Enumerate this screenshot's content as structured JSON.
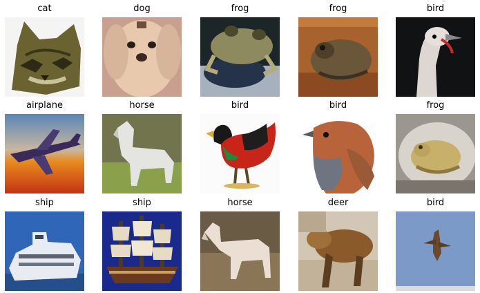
{
  "grid": {
    "rows": [
      [
        {
          "label": "cat"
        },
        {
          "label": "dog"
        },
        {
          "label": "frog"
        },
        {
          "label": "frog"
        },
        {
          "label": "bird"
        }
      ],
      [
        {
          "label": "airplane"
        },
        {
          "label": "horse"
        },
        {
          "label": "bird"
        },
        {
          "label": "bird"
        },
        {
          "label": "frog"
        }
      ],
      [
        {
          "label": "ship"
        },
        {
          "label": "ship"
        },
        {
          "label": "horse"
        },
        {
          "label": "deer"
        },
        {
          "label": "bird"
        }
      ]
    ]
  }
}
